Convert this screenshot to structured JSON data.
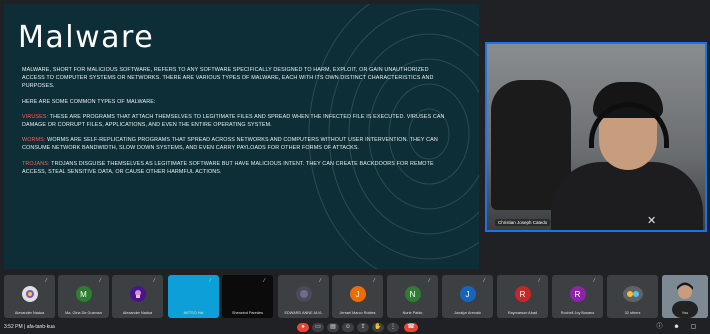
{
  "slide": {
    "title": "Malware",
    "intro": "Malware, short for malicious software, refers to any software specifically designed to harm, exploit, or gain unauthorized access to computer systems or networks. There are various types of malware, each with its own distinct characteristics and purposes.",
    "list_intro": "Here are some common types of malware:",
    "items": [
      {
        "term": "Viruses:",
        "text": "These are programs that attach themselves to legitimate files and spread when the infected file is executed. Viruses can damage or corrupt files, applications, and even the entire operating system."
      },
      {
        "term": "Worms:",
        "text": "Worms are self-replicating programs that spread across networks and computers without user intervention. They can consume network bandwidth, slow down systems, and even carry payloads for other forms of attacks."
      },
      {
        "term": "Trojans:",
        "text": "Trojans disguise themselves as legitimate software but have malicious intent. They can create backdoors for remote access, steal sensitive data, or cause other harmful actions."
      }
    ],
    "accent_color": "#ff5d5d",
    "bg_color": "#0d2e36"
  },
  "main_camera": {
    "label": "Christian Joseph Catedo"
  },
  "participants": [
    {
      "name": "Alexander Nadua",
      "initial": "",
      "color": "#8e5ed6",
      "mic": "mic-off-icon"
    },
    {
      "name": "Ma. Gina De Guzman",
      "initial": "M",
      "color": "#2e7d32",
      "mic": "mic-off-icon"
    },
    {
      "name": "Alexander Nadua",
      "initial": "",
      "color": "#6a1b9a",
      "mic": "mic-off-icon"
    },
    {
      "name": "NETSO Hst",
      "initial": "",
      "color": "#0288d1",
      "mic": "mic-off-icon"
    },
    {
      "name": "Sherwind Paredes",
      "initial": "",
      "color": "#111111",
      "mic": "mic-off-icon"
    },
    {
      "name": "EDWARD ANNE ALVL",
      "initial": "",
      "color": "#5a4a6a",
      "mic": "mic-off-icon"
    },
    {
      "name": "Jerrael Marco Robles",
      "initial": "J",
      "color": "#ef6c00",
      "mic": "mic-off-icon"
    },
    {
      "name": "Norie Pablo",
      "initial": "N",
      "color": "#2e7d32",
      "mic": "mic-off-icon"
    },
    {
      "name": "Jonalyn Arevalo",
      "initial": "J",
      "color": "#1565c0",
      "mic": "mic-off-icon"
    },
    {
      "name": "Raymarson Abad",
      "initial": "R",
      "color": "#c62828",
      "mic": "mic-off-icon"
    },
    {
      "name": "Rochell Joy Busano",
      "initial": "R",
      "color": "#8e24aa",
      "mic": "mic-off-icon"
    },
    {
      "name": "32 others",
      "initial": "",
      "color": "#5f6368",
      "mic": ""
    }
  ],
  "self_tile": {
    "name": "You"
  },
  "bottom_bar": {
    "time": "3:52 PM | afa-tanb-kua",
    "controls": [
      "mic-icon",
      "camera-icon",
      "captions-icon",
      "emoji-icon",
      "present-icon",
      "raise-hand-icon",
      "more-icon",
      "end-call-icon"
    ],
    "right_icons": [
      "info-icon",
      "people-icon",
      "chat-icon"
    ]
  }
}
